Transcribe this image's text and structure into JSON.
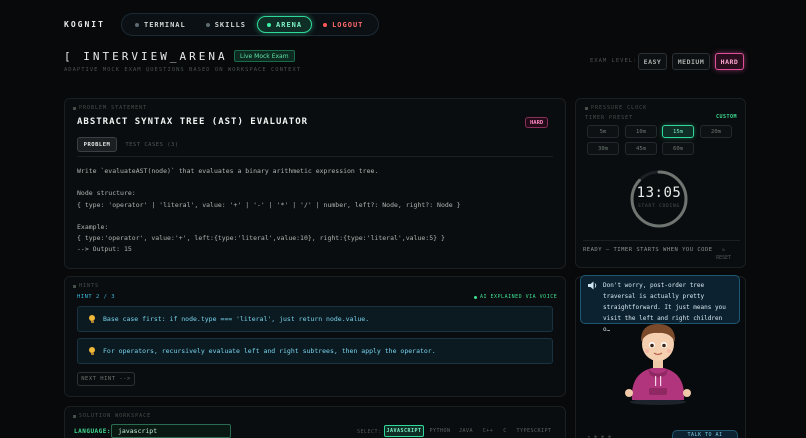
{
  "app": {
    "logo": "KOGNIT"
  },
  "nav": [
    {
      "label": "TERMINAL"
    },
    {
      "label": "SKILLS"
    },
    {
      "label": "ARENA"
    },
    {
      "label": "LOGOUT"
    }
  ],
  "header": {
    "title": "[ INTERVIEW_ARENA ]",
    "badge": "Live Mock Exam",
    "subtitle": "ADAPTIVE MOCK EXAM QUESTIONS BASED ON WORKSPACE CONTEXT",
    "level_label": "EXAM LEVEL:",
    "levels": [
      "EASY",
      "MEDIUM",
      "HARD"
    ],
    "selected_level": "HARD"
  },
  "problem": {
    "section_label": "PROBLEM STATEMENT",
    "title": "ABSTRACT SYNTAX TREE (AST) EVALUATOR",
    "difficulty": "HARD",
    "tabs": [
      "PROBLEM",
      "TEST CASES (3)"
    ],
    "lines": [
      "Write `evaluateAST(node)` that evaluates a binary arithmetic expression tree.",
      "Node structure:",
      "{ type: 'operator' | 'literal', value: '+' | '-' | '*' | '/' | number, left?: Node, right?: Node }",
      "Example:",
      "{ type:'operator', value:'+', left:{type:'literal',value:10}, right:{type:'literal',value:5} }",
      "--> Output: 15"
    ]
  },
  "hints": {
    "section_label": "HINTS",
    "count": "HINT 2 / 3",
    "ai_label": "AI EXPLAINED VIA VOICE",
    "items": [
      "Base case first: if node.type === 'literal', just return node.value.",
      "For operators, recursively evaluate left and right subtrees, then apply the operator."
    ],
    "next_label": "NEXT HINT -->"
  },
  "workspace": {
    "section_label": "SOLUTION WORKSPACE",
    "language_label": "LANGUAGE:",
    "language_value": "javascript",
    "select_label": "SELECT:",
    "options": [
      "JAVASCRIPT",
      "PYTHON",
      "JAVA",
      "C++",
      "C",
      "TYPESCRIPT"
    ],
    "selected": "JAVASCRIPT"
  },
  "clock": {
    "section_label": "PRESSURE CLOCK",
    "preset_label": "TIMER PRESET",
    "custom_label": "CUSTOM",
    "presets": [
      "5m",
      "10m",
      "15m",
      "20m",
      "30m",
      "45m",
      "60m"
    ],
    "selected_preset": "15m",
    "time": "13:05",
    "sub": "START CODING",
    "status": "READY — TIMER STARTS WHEN YOU CODE",
    "reset": "RESET",
    "progress": 0.87
  },
  "assistant": {
    "message": "Don't worry, post-order tree traversal is actually pretty straightforward. It just means you visit the left and right children o…",
    "talk_label": "TALK TO AI",
    "colors": {
      "bubble": "#0d2230",
      "hoodie": "#b1357c"
    }
  },
  "colors": {
    "accent": "#2fd99a",
    "hard": "#e0509a",
    "hint": "#39b6d8"
  }
}
